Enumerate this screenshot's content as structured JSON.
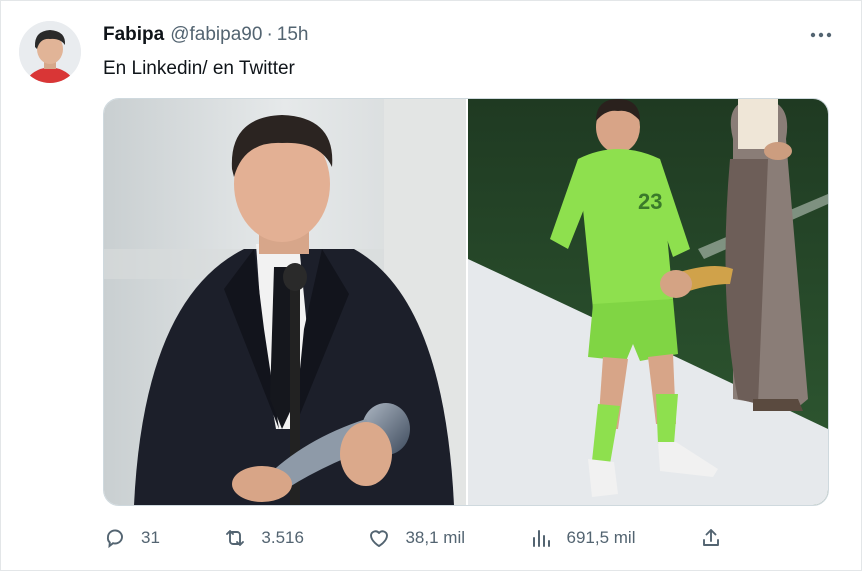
{
  "tweet": {
    "author_name": "Fabipa",
    "author_handle": "@fabipa90",
    "separator": "·",
    "time": "15h",
    "text": "En Linkedin/ en Twitter",
    "media": [
      {
        "icon": "award-ceremony-photo"
      },
      {
        "icon": "goalkeeper-celebration-photo"
      }
    ]
  },
  "actions": {
    "reply_count": "31",
    "retweet_count": "3.516",
    "like_count": "38,1 mil",
    "view_count": "691,5 mil"
  },
  "colors": {
    "text_primary": "#0f1419",
    "text_secondary": "#536471",
    "border": "#cfd9de",
    "background": "#ffffff"
  }
}
